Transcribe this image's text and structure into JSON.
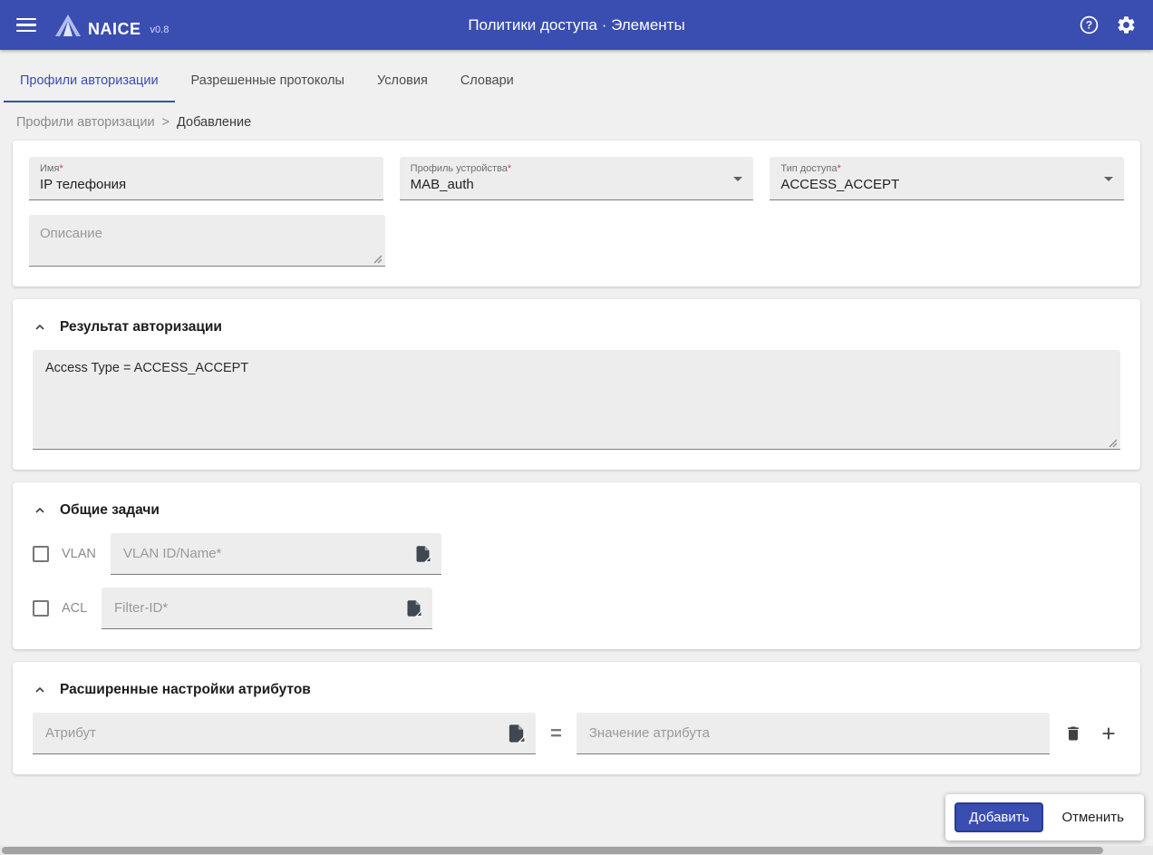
{
  "colors": {
    "header-bg": "#3a4db0",
    "accent": "#3a4db0",
    "required": "#e53935"
  },
  "header": {
    "app_name": "NAICE",
    "app_version": "v0.8",
    "title": "Политики доступа · Элементы"
  },
  "tabs": [
    {
      "label": "Профили авторизации"
    },
    {
      "label": "Разрешенные протоколы"
    },
    {
      "label": "Условия"
    },
    {
      "label": "Словари"
    }
  ],
  "breadcrumb": {
    "root": "Профили авторизации",
    "separator": ">",
    "current": "Добавление"
  },
  "form": {
    "name": {
      "label": "Имя",
      "required": "*",
      "value": "IP телефония"
    },
    "device_profile": {
      "label": "Профиль устройства",
      "required": "*",
      "value": "MAB_auth"
    },
    "access_type": {
      "label": "Тип доступа",
      "required": "*",
      "value": "ACCESS_ACCEPT"
    },
    "description": {
      "placeholder": "Описание"
    }
  },
  "authorization_result": {
    "title": "Результат авторизации",
    "value": "Access Type = ACCESS_ACCEPT"
  },
  "common_tasks": {
    "title": "Общие задачи",
    "vlan": {
      "label": "VLAN",
      "placeholder": "VLAN ID/Name*"
    },
    "acl": {
      "label": "ACL",
      "placeholder": "Filter-ID*"
    }
  },
  "advanced_attributes": {
    "title": "Расширенные настройки атрибутов",
    "attribute_placeholder": "Атрибут",
    "equals": "=",
    "value_placeholder": "Значение атрибута"
  },
  "actions": {
    "submit": "Добавить",
    "cancel": "Отменить"
  }
}
